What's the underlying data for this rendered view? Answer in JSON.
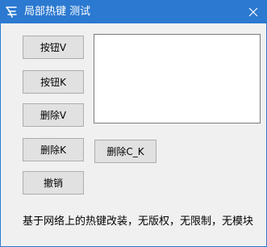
{
  "window": {
    "title": "局部热键 测试",
    "accent_color": "#2b79d0",
    "icon": "app-logo-icon",
    "close_icon": "close-icon"
  },
  "buttons": {
    "b1": "按钮V",
    "b2": "按钮K",
    "b3": "删除V",
    "b4": "删除K",
    "b5": "删除C_K",
    "b6": "撤销"
  },
  "text_area": {
    "value": ""
  },
  "status_text": "基于网络上的热键改装，无版权，无限制，无模块"
}
